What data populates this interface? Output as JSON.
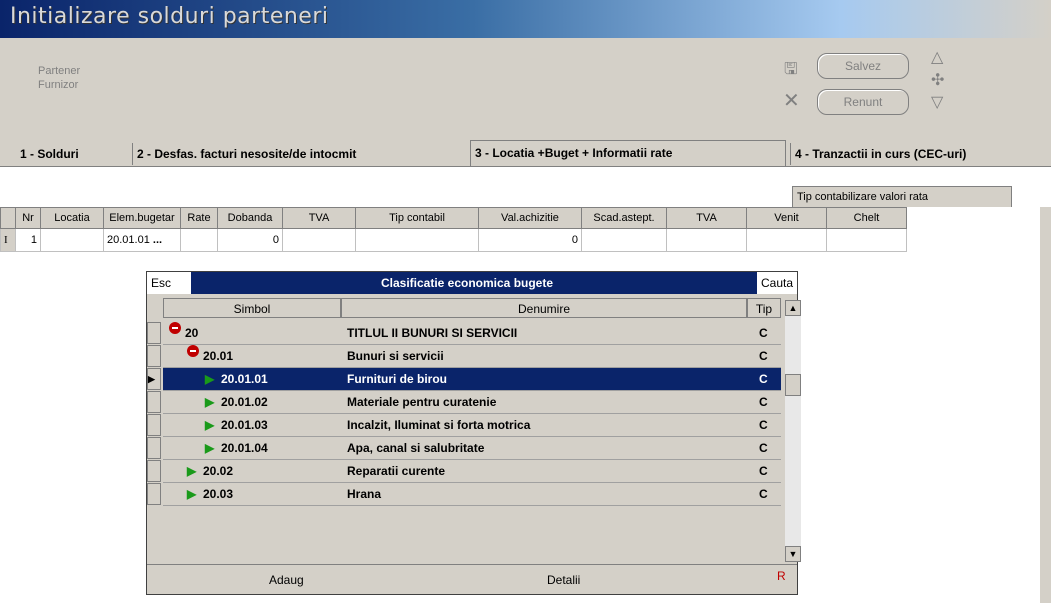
{
  "window": {
    "title": "Initializare solduri parteneri"
  },
  "header": {
    "label1": "Partener",
    "label2": "Furnizor",
    "save_label": "Salvez",
    "cancel_label": "Renunt"
  },
  "tabs": [
    {
      "label": "1 - Solduri"
    },
    {
      "label": "2 - Desfas. facturi nesosite/de intocmit"
    },
    {
      "label": "3 - Locatia +Buget + Informatii rate"
    },
    {
      "label": "4 - Tranzactii in curs (CEC-uri)"
    }
  ],
  "grid": {
    "group_header": "Tip contabilizare valori rata",
    "columns": [
      "Nr",
      "Locatia",
      "Elem.bugetar",
      "Rate",
      "Dobanda",
      "TVA",
      "Tip contabil",
      "Val.achizitie",
      "Scad.astept.",
      "TVA",
      "Venit",
      "Chelt"
    ],
    "row": {
      "indicator": "I",
      "nr": "1",
      "elem_bugetar": "20.01.01",
      "ellipsis": "...",
      "dobanda": "0",
      "val_achizitie": "0"
    }
  },
  "popup": {
    "esc": "Esc",
    "title": "Clasificatie economica bugete",
    "search": "Cauta",
    "columns": [
      "Simbol",
      "Denumire",
      "Tip"
    ],
    "rows": [
      {
        "simbol": "20",
        "denumire": "TITLUL II BUNURI SI SERVICII",
        "tip": "C",
        "icon": "minus-icon",
        "level": 0
      },
      {
        "simbol": "20.01",
        "denumire": "Bunuri si servicii",
        "tip": "C",
        "icon": "minus-icon",
        "level": 1
      },
      {
        "simbol": "20.01.01",
        "denumire": "Furnituri de birou",
        "tip": "C",
        "icon": "play-icon",
        "level": 2,
        "selected": true
      },
      {
        "simbol": "20.01.02",
        "denumire": "Materiale pentru curatenie",
        "tip": "C",
        "icon": "play-icon",
        "level": 2
      },
      {
        "simbol": "20.01.03",
        "denumire": "Incalzit, Iluminat si forta motrica",
        "tip": "C",
        "icon": "play-icon",
        "level": 2
      },
      {
        "simbol": "20.01.04",
        "denumire": "Apa, canal si salubritate",
        "tip": "C",
        "icon": "play-icon",
        "level": 2
      },
      {
        "simbol": "20.02",
        "denumire": "Reparatii curente",
        "tip": "C",
        "icon": "play-icon",
        "level": 1
      },
      {
        "simbol": "20.03",
        "denumire": "Hrana",
        "tip": "C",
        "icon": "play-icon",
        "level": 1
      }
    ],
    "add_label": "Adaug",
    "details_label": "Detalii",
    "r_label": "R"
  }
}
